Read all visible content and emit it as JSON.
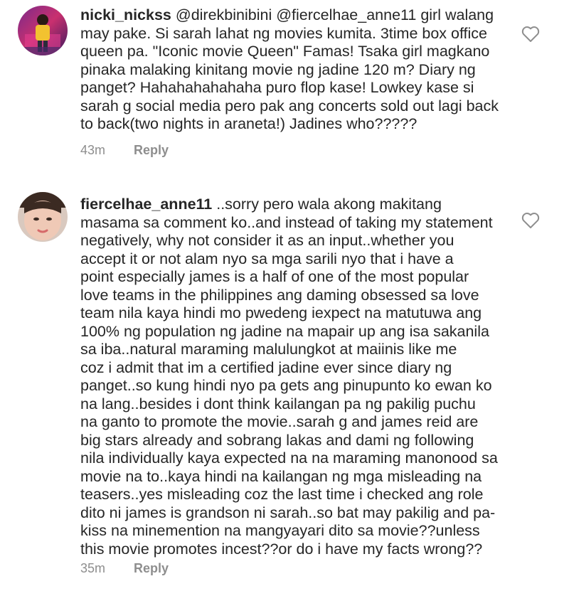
{
  "comments": [
    {
      "username": "nicki_nickss",
      "lines": [
        " @direkbinibini @fiercelhae_anne11 girl walang",
        "may pake. Si sarah lahat ng movies kumita. 3time box office",
        "queen pa. \"Iconic movie Queen\" Famas! Tsaka girl magkano",
        "pinaka malaking kinitang movie ng jadine 120 m? Diary ng",
        "panget? Hahahahahahaha puro flop kase! Lowkey kase si",
        "sarah g social media pero pak ang concerts sold out lagi back",
        "to back(two nights in araneta!) Jadines who?????"
      ],
      "time": "43m",
      "reply_label": "Reply",
      "avatar_icon": "user-avatar-yellow-jacket",
      "like_icon": "heart-outline-icon"
    },
    {
      "username": "fiercelhae_anne11",
      "lines": [
        " ..sorry pero wala akong makitang",
        "masama sa comment ko..and instead of taking my statement",
        "negatively, why not consider it as an input..whether you",
        "accept it or not alam nyo sa mga sarili nyo that i have a",
        "point especially james is a half of one of the most popular",
        "love teams in the philippines ang daming obsessed sa love",
        "team nila kaya hindi mo pwedeng iexpect na matutuwa ang",
        "100% ng population ng jadine na mapair up ang isa sakanila",
        "sa iba..natural maraming malulungkot at maiinis like me",
        "coz i admit that im a certified jadine ever since diary ng",
        "panget..so kung hindi nyo pa gets ang pinupunto ko ewan ko",
        "na lang..besides i dont think kailangan pa ng pakilig puchu",
        "na ganto to promote the movie..sarah g and james reid are",
        "big stars already and sobrang lakas and dami ng following",
        "nila individually kaya expected na na maraming manonood sa",
        "movie na to..kaya hindi na kailangan ng mga misleading na",
        "teasers..yes misleading coz the last time i checked ang role",
        "dito ni james is grandson ni sarah..so bat may pakilig and pa-",
        "kiss na minemention na mangyayari dito sa movie??unless",
        "this movie promotes incest??or do i have my facts wrong??"
      ],
      "time": "35m",
      "reply_label": "Reply",
      "avatar_icon": "user-avatar-face",
      "like_icon": "heart-outline-icon"
    }
  ]
}
